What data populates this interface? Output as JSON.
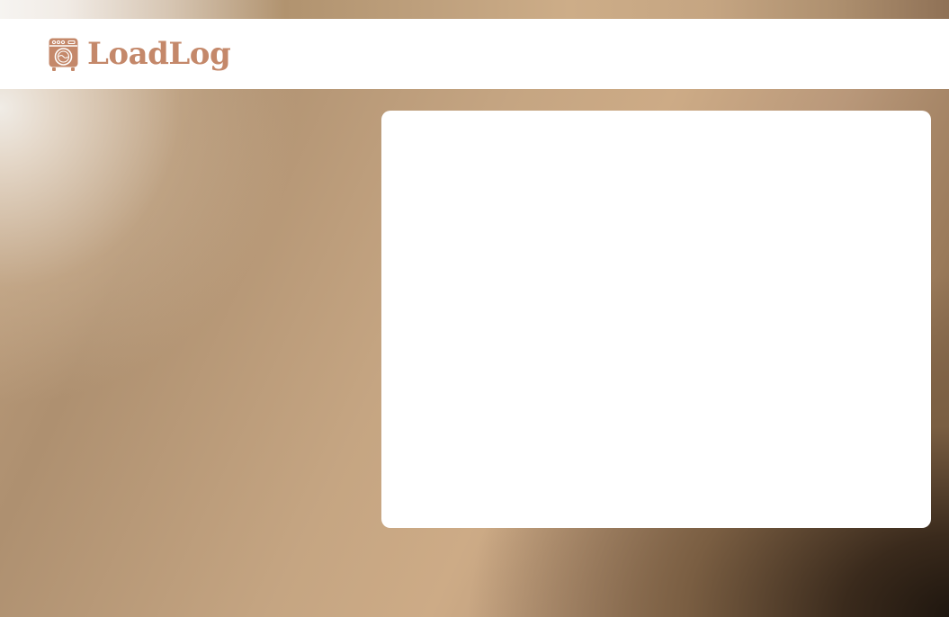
{
  "app": {
    "name": "LoadLog",
    "logo_icon": "washing-machine-icon"
  },
  "colors": {
    "brand": "#c4886a",
    "header_background": "#ffffff",
    "card_background": "#ffffff"
  }
}
